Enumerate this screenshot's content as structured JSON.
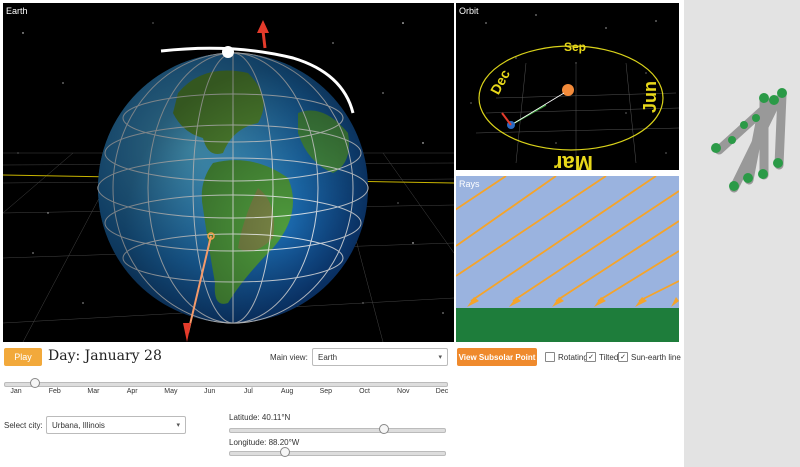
{
  "panels": {
    "earth_label": "Earth",
    "orbit_label": "Orbit",
    "rays_label": "Rays"
  },
  "orbit_months": {
    "sep": "Sep",
    "dec": "Dec",
    "jun": "Jun",
    "mar": "Mar"
  },
  "controls": {
    "play_label": "Play",
    "day_text": "Day: January 28",
    "main_view_label": "Main view:",
    "main_view_value": "Earth",
    "subsolar_label": "View Subsolar Point",
    "rotating_label": "Rotating",
    "rotating_checked": false,
    "tilted_label": "Tilted",
    "tilted_checked": true,
    "sun_earth_label": "Sun-earth line",
    "sun_earth_checked": true,
    "day_slider_fraction": 0.07,
    "months": [
      "Jan",
      "Feb",
      "Mar",
      "Apr",
      "May",
      "Jun",
      "Jul",
      "Aug",
      "Sep",
      "Oct",
      "Nov",
      "Dec"
    ],
    "select_city_label": "Select city:",
    "city_value": "Urbana, Illinois",
    "latitude_label": "Latitude: 40.11°N",
    "latitude_fraction": 0.72,
    "longitude_label": "Longitude: 88.20°W",
    "longitude_fraction": 0.26
  },
  "colors": {
    "play": "#f2a93b",
    "subsolar": "#ef8a2d",
    "rays_sky": "#9ab3df",
    "rays_ground": "#1e7d3b",
    "ray": "#f5a42a",
    "orbit": "#d9d21a",
    "sun": "#f28a3a"
  }
}
